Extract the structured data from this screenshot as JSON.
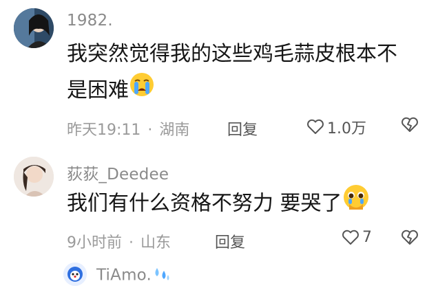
{
  "comments": [
    {
      "username": "1982.",
      "text_line1": "我突然觉得我的这些鸡毛蒜皮根本不",
      "text_line2": "是困难",
      "emoji": "crying-face-emoji",
      "time": "昨天19:11",
      "sep": "·",
      "location": "湖南",
      "reply_label": "回复",
      "likes": "1.0万"
    },
    {
      "username": "荻荻_Deedee",
      "text": "我们有什么资格不努力 要哭了",
      "emoji": "pleading-face-emoji",
      "time": "9小时前",
      "sep": "·",
      "location": "山东",
      "reply_label": "回复",
      "likes": "7"
    }
  ],
  "reply_preview": {
    "username": "TiAmo.",
    "emoji": "sweat-droplets-emoji"
  },
  "colors": {
    "meta": "#9a9a9a",
    "text": "#161616",
    "username": "#8a8a8a"
  }
}
